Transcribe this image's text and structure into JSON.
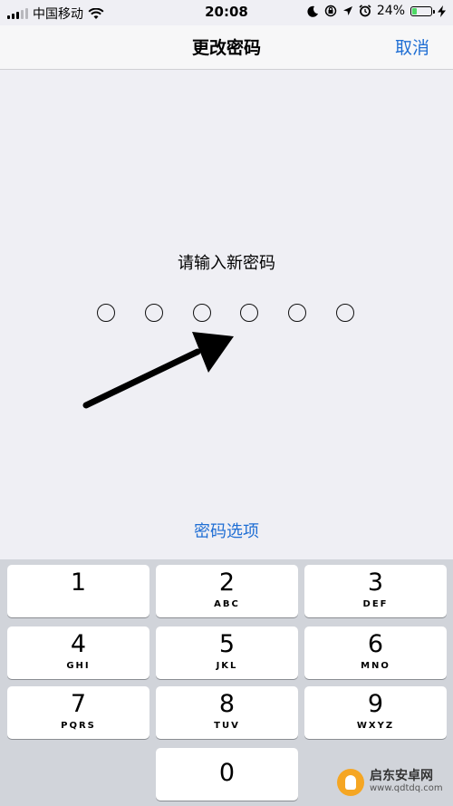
{
  "status_bar": {
    "carrier": "中国移动",
    "time": "20:08",
    "battery": "24%",
    "battery_level": 0.24,
    "icons": [
      "signal-icon",
      "wifi-icon",
      "moon-icon",
      "rotation-lock-icon",
      "location-icon",
      "alarm-icon",
      "battery-icon",
      "charging-icon"
    ]
  },
  "nav": {
    "title": "更改密码",
    "cancel": "取消"
  },
  "prompt": "请输入新密码",
  "passcode_length": 6,
  "options_link": "密码选项",
  "keypad": [
    {
      "num": "1",
      "letters": ""
    },
    {
      "num": "2",
      "letters": "ABC"
    },
    {
      "num": "3",
      "letters": "DEF"
    },
    {
      "num": "4",
      "letters": "GHI"
    },
    {
      "num": "5",
      "letters": "JKL"
    },
    {
      "num": "6",
      "letters": "MNO"
    },
    {
      "num": "7",
      "letters": "PQRS"
    },
    {
      "num": "8",
      "letters": "TUV"
    },
    {
      "num": "9",
      "letters": "WXYZ"
    },
    {
      "num": "0",
      "letters": ""
    }
  ],
  "watermark": {
    "name": "启东安卓网",
    "url": "www.qdtdq.com"
  },
  "colors": {
    "accent": "#1f6ed4",
    "background": "#efeff4",
    "keypad_bg": "#d1d4da",
    "battery_fill": "#4cd964"
  }
}
